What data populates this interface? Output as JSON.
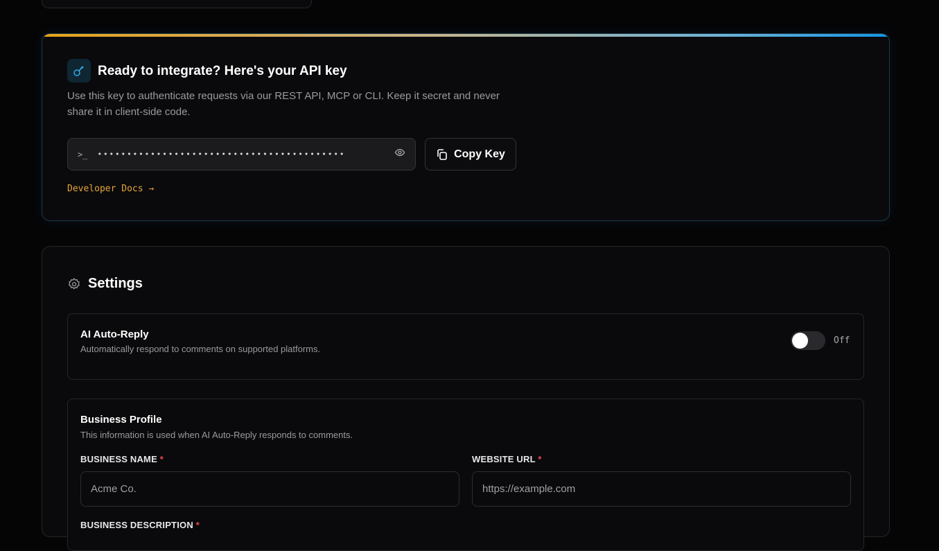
{
  "api": {
    "title": "Ready to integrate? Here's your API key",
    "description": "Use this key to authenticate requests via our REST API, MCP or CLI. Keep it secret and never share it in client-side code.",
    "prompt": ">_",
    "masked_key": "••••••••••••••••••••••••••••••••••••••••••",
    "copy_label": "Copy Key",
    "docs_label": "Developer Docs →"
  },
  "settings": {
    "title": "Settings",
    "auto_reply": {
      "title": "AI Auto-Reply",
      "description": "Automatically respond to comments on supported platforms.",
      "state": "Off",
      "enabled": false
    },
    "profile": {
      "title": "Business Profile",
      "description": "This information is used when AI Auto-Reply responds to comments.",
      "business_name_label": "BUSINESS NAME",
      "business_name_placeholder": "Acme Co.",
      "website_label": "WEBSITE URL",
      "website_placeholder": "https://example.com",
      "description_label": "BUSINESS DESCRIPTION",
      "required_mark": "*"
    }
  }
}
